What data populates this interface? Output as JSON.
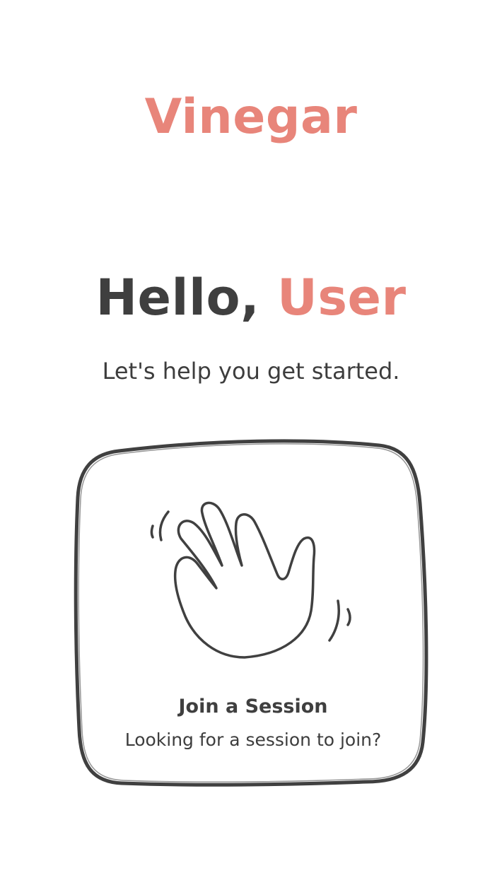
{
  "app": {
    "brand": "Vinegar"
  },
  "hero": {
    "greeting_prefix": "Hello,",
    "user_name": "User",
    "subtitle": "Let's help you get started."
  },
  "cards": [
    {
      "icon": "waving-hand-icon",
      "title": "Join a Session",
      "description": "Looking for a session to join?"
    }
  ],
  "colors": {
    "accent": "#e8857a",
    "text": "#3f3f3f",
    "card_border": "#404040",
    "background": "#ffffff"
  }
}
